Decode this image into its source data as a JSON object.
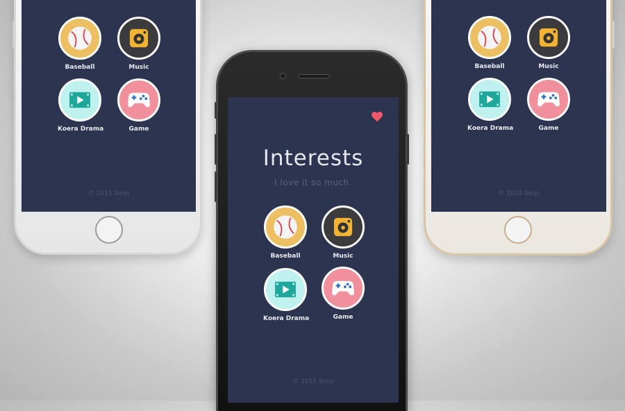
{
  "app": {
    "title": "Interests",
    "subtitle": "I love it so much.",
    "footer": "© 2015 Sinyi",
    "accent_color": "#ef5a6b",
    "screen_color": "#2d344f"
  },
  "interests": [
    {
      "label": "Baseball",
      "icon": "baseball-icon",
      "color": "#ecc062"
    },
    {
      "label": "Music",
      "icon": "music-player-icon",
      "color": "#3b3a3c"
    },
    {
      "label": "Koera Drama",
      "icon": "film-play-icon",
      "color": "#bff2ef"
    },
    {
      "label": "Game",
      "icon": "gamepad-icon",
      "color": "#f0909c"
    }
  ],
  "favorite_icon": "heart-icon"
}
